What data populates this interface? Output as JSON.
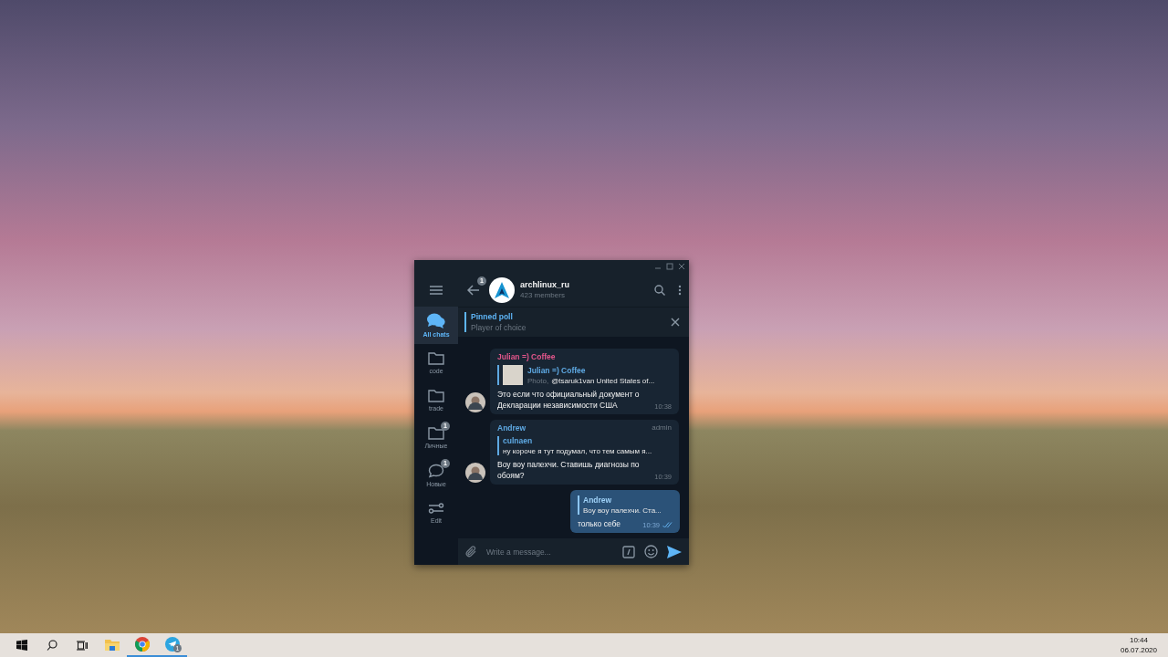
{
  "sidebar": {
    "items": [
      {
        "kind": "chats",
        "label": "All chats",
        "selected": true
      },
      {
        "kind": "folder",
        "label": "code",
        "selected": false
      },
      {
        "kind": "folder",
        "label": "trade",
        "selected": false
      },
      {
        "kind": "folder",
        "label": "Личные",
        "selected": false,
        "badge": "1"
      },
      {
        "kind": "bubble",
        "label": "Новые",
        "selected": false,
        "badge": "1"
      },
      {
        "kind": "edit",
        "label": "Edit",
        "selected": false
      }
    ]
  },
  "chat": {
    "back_badge": "1",
    "title": "archlinux_ru",
    "subtitle": "423 members"
  },
  "pinned": {
    "title": "Pinned poll",
    "text": "Player of choice"
  },
  "messages": [
    {
      "kind": "incoming",
      "sender": "Julian =) Coffee",
      "color": "#e3568b",
      "reply": {
        "author": "Julian =) Coffee",
        "media": "Photo,",
        "text": "@tsaruk1van United States of..."
      },
      "text": "Это если что официальный документ о Декларации независимости США",
      "time": "10:38"
    },
    {
      "kind": "incoming",
      "sender": "Andrew",
      "color": "#5ea9e3",
      "role": "admin",
      "reply": {
        "author": "culnaen",
        "text": "ну короче я тут подумал, что тем самым я..."
      },
      "text": "Воу воу палехчи. Ставишь диагнозы по обоям?",
      "time": "10:39"
    },
    {
      "kind": "outgoing",
      "reply": {
        "author": "Andrew",
        "text": "Воу воу палехчи. Ста..."
      },
      "text": "только себе",
      "time": "10:39",
      "read": true
    }
  ],
  "composer": {
    "placeholder": "Write a message..."
  },
  "taskbar": {
    "apps": [
      {
        "kind": "folder",
        "running": false
      },
      {
        "kind": "chrome",
        "running": true
      },
      {
        "kind": "telegram",
        "running": true,
        "badge": "1"
      }
    ],
    "time": "10:44",
    "date": "06.07.2020"
  }
}
